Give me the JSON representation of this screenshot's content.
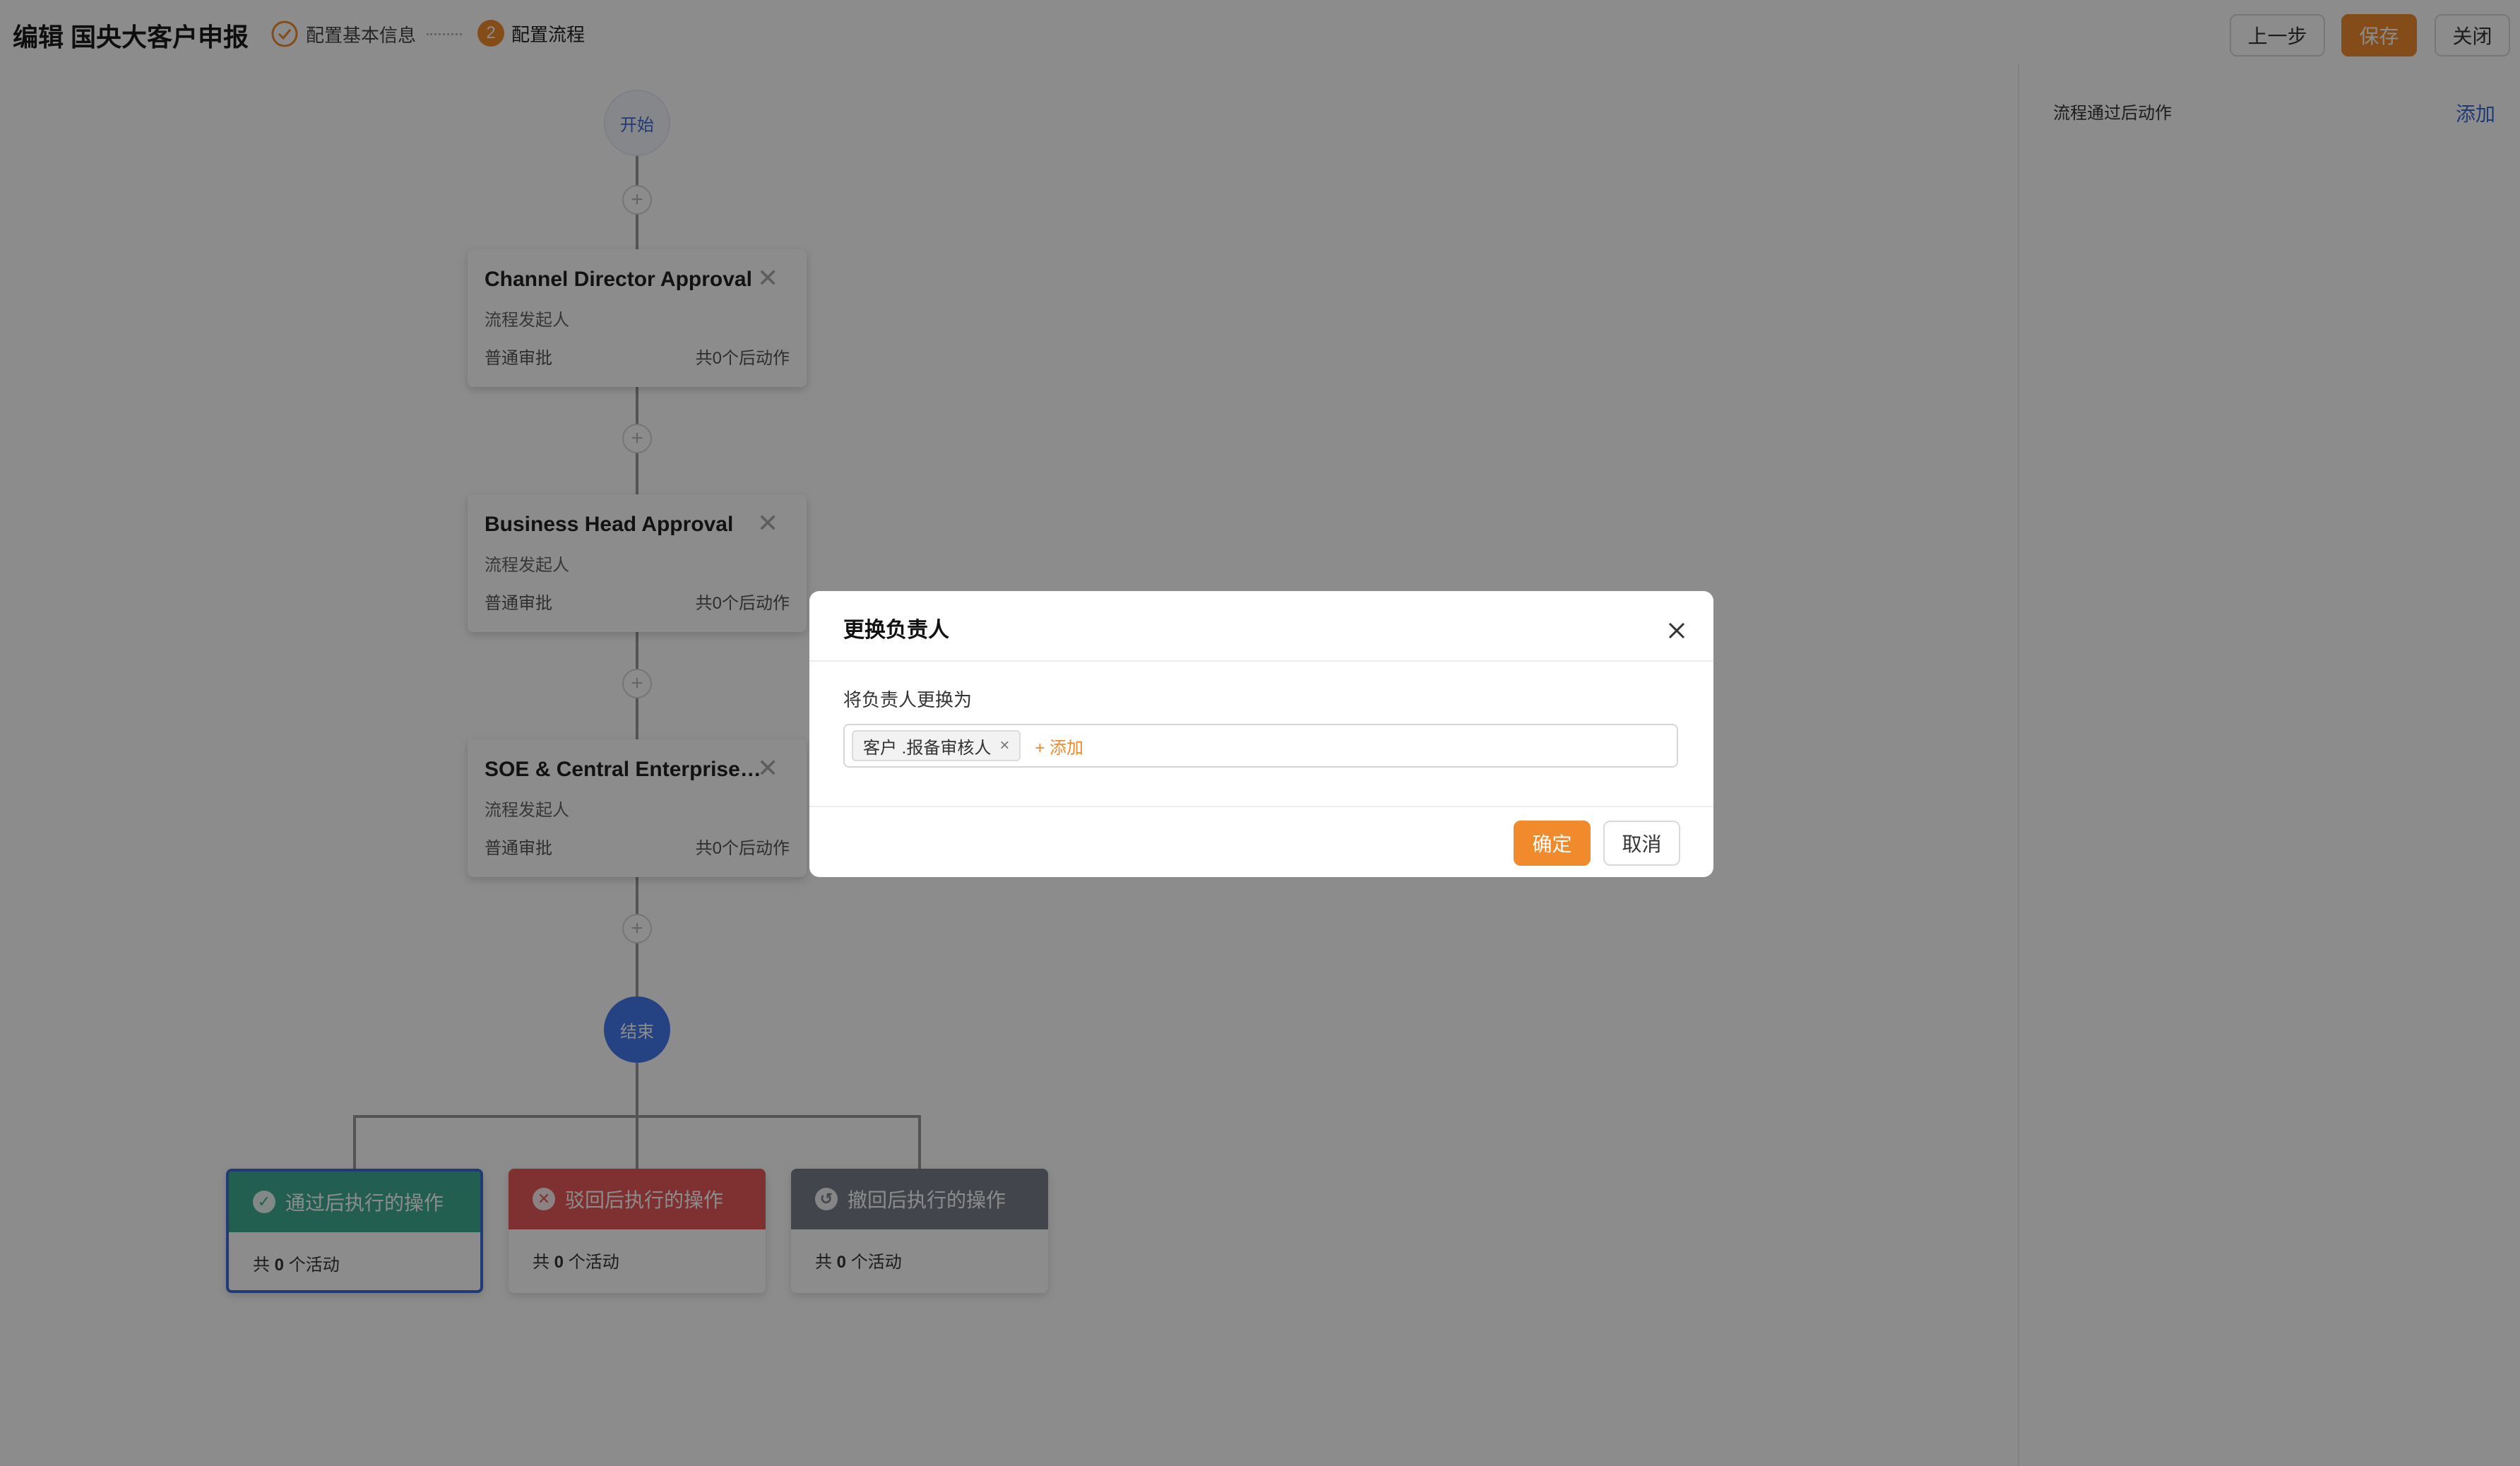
{
  "header": {
    "title": "编辑 国央大客户申报",
    "steps": [
      {
        "label": "配置基本信息",
        "state": "done"
      },
      {
        "number": "2",
        "label": "配置流程",
        "state": "active"
      }
    ],
    "buttons": {
      "prev": "上一步",
      "save": "保存",
      "close": "关闭"
    }
  },
  "flow": {
    "start": "开始",
    "end": "结束",
    "add_symbol": "+",
    "nodes": [
      {
        "title": "Channel Director Approval",
        "initiator": "流程发起人",
        "type": "普通审批",
        "actions": "共0个后动作"
      },
      {
        "title": "Business Head Approval",
        "initiator": "流程发起人",
        "type": "普通审批",
        "actions": "共0个后动作"
      },
      {
        "title": "SOE & Central Enterprise Business Approval",
        "initiator": "流程发起人",
        "type": "普通审批",
        "actions": "共0个后动作"
      }
    ],
    "operations": [
      {
        "title": "通过后执行的操作",
        "count_prefix": "共",
        "count": "0",
        "count_suffix": "个活动",
        "color": "#3fae92"
      },
      {
        "title": "驳回后执行的操作",
        "count_prefix": "共",
        "count": "0",
        "count_suffix": "个活动",
        "color": "#e85a5a"
      },
      {
        "title": "撤回后执行的操作",
        "count_prefix": "共",
        "count": "0",
        "count_suffix": "个活动",
        "color": "#7a7f8a"
      }
    ]
  },
  "panel": {
    "title": "流程通过后动作",
    "add": "添加"
  },
  "dialog": {
    "title": "更换负责人",
    "label": "将负责人更换为",
    "tags": [
      "客户 .报备审核人"
    ],
    "add_link": "+ 添加",
    "ok": "确定",
    "cancel": "取消"
  },
  "colors": {
    "accent": "#f08a2c",
    "link": "#3a6ad6",
    "end_node": "#4479ee"
  }
}
